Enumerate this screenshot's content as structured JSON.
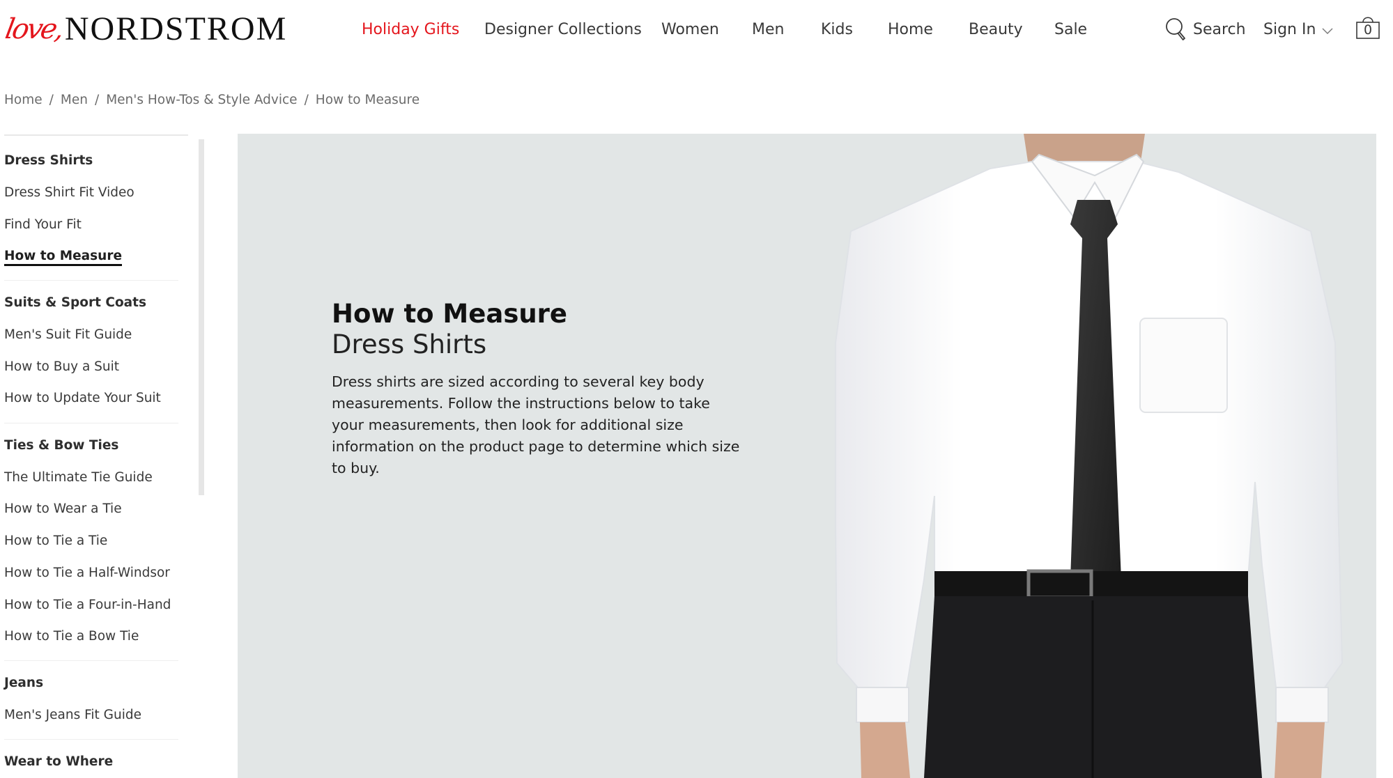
{
  "brand": {
    "script": "love,",
    "wordmark": "NORDSTROM",
    "accent_color": "#e4161d"
  },
  "nav": {
    "items": [
      {
        "label": "Holiday Gifts",
        "accent": true
      },
      {
        "label": "Designer Collections"
      },
      {
        "label": "Women"
      },
      {
        "label": "Men"
      },
      {
        "label": "Kids"
      },
      {
        "label": "Home"
      },
      {
        "label": "Beauty"
      },
      {
        "label": "Sale"
      }
    ],
    "search_label": "Search",
    "search_icon": "search-icon",
    "signin_label": "Sign In",
    "signin_icon": "chevron-down-icon",
    "bag_count": "0",
    "bag_icon": "shopping-bag-icon"
  },
  "breadcrumb": {
    "separator": "/",
    "items": [
      "Home",
      "Men",
      "Men's How-Tos & Style Advice",
      "How to Measure"
    ]
  },
  "sidebar": {
    "groups": [
      {
        "heading": "Dress Shirts",
        "links": [
          {
            "label": "Dress Shirt Fit Video"
          },
          {
            "label": "Find Your Fit"
          },
          {
            "label": "How to Measure",
            "active": true
          }
        ]
      },
      {
        "heading": "Suits & Sport Coats",
        "links": [
          {
            "label": "Men's Suit Fit Guide"
          },
          {
            "label": "How to Buy a Suit"
          },
          {
            "label": "How to Update Your Suit"
          }
        ]
      },
      {
        "heading": "Ties & Bow Ties",
        "links": [
          {
            "label": "The Ultimate Tie Guide"
          },
          {
            "label": "How to Wear a Tie"
          },
          {
            "label": "How to Tie a Tie"
          },
          {
            "label": "How to Tie a Half-Windsor"
          },
          {
            "label": "How to Tie a Four-in-Hand"
          },
          {
            "label": "How to Tie a Bow Tie"
          }
        ]
      },
      {
        "heading": "Jeans",
        "links": [
          {
            "label": "Men's Jeans Fit Guide"
          }
        ]
      },
      {
        "heading": "Wear to Where",
        "links": []
      }
    ]
  },
  "hero": {
    "title": "How to Measure",
    "subtitle": "Dress Shirts",
    "body": "Dress shirts are sized according to several key body measurements. Follow the instructions below to take your measurements, then look for additional size information on the product page to determine which size to buy.",
    "image_alt": "Man wearing white dress shirt, black tie, black belt and trousers",
    "background_color": "#e2e6e6"
  }
}
